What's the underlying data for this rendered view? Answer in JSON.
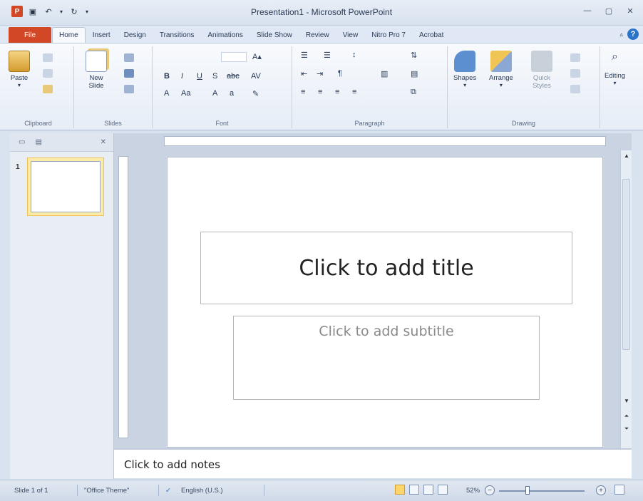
{
  "window": {
    "title": "Presentation1 - Microsoft PowerPoint"
  },
  "tabs": [
    "File",
    "Home",
    "Insert",
    "Design",
    "Transitions",
    "Animations",
    "Slide Show",
    "Review",
    "View",
    "Nitro Pro 7",
    "Acrobat"
  ],
  "ribbon": {
    "clipboard": {
      "paste": "Paste",
      "label": "Clipboard"
    },
    "slides": {
      "new_slide": "New Slide",
      "label": "Slides"
    },
    "font": {
      "bold": "B",
      "italic": "I",
      "underline": "U",
      "label": "Font"
    },
    "paragraph": {
      "label": "Paragraph"
    },
    "drawing": {
      "shapes": "Shapes",
      "arrange": "Arrange",
      "quick_styles": "Quick Styles",
      "label": "Drawing"
    },
    "editing": {
      "label": "Editing"
    }
  },
  "slides_panel": {
    "slide_number": "1"
  },
  "slide": {
    "title_placeholder": "Click to add title",
    "subtitle_placeholder": "Click to add subtitle"
  },
  "notes": {
    "placeholder": "Click to add notes"
  },
  "statusbar": {
    "slide_info": "Slide 1 of 1",
    "theme": "\"Office Theme\"",
    "language": "English (U.S.)",
    "zoom": "52%"
  },
  "colors": {
    "file_tab": "#d24726",
    "ribbon_bg": "#e6edf6",
    "thumb_highlight": "#fde9a8"
  }
}
